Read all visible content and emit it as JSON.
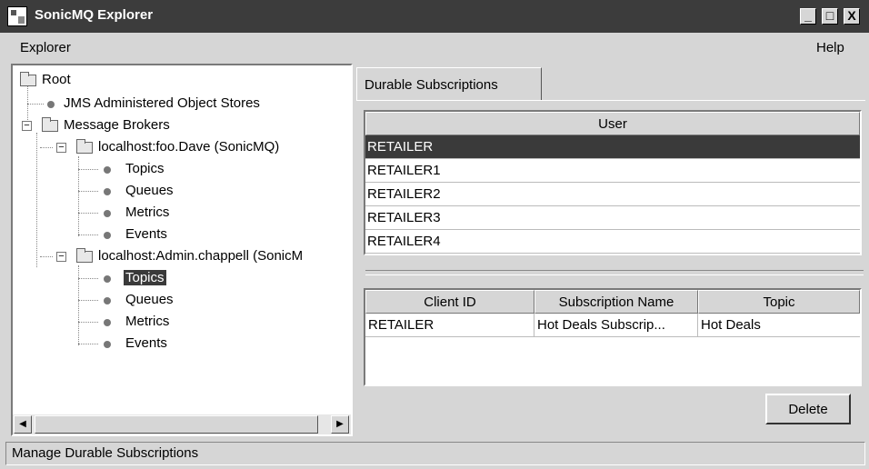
{
  "window": {
    "title": "SonicMQ Explorer",
    "buttons": {
      "minimize": "_",
      "maximize": "□",
      "close": "X"
    }
  },
  "menubar": {
    "explorer": "Explorer",
    "help": "Help"
  },
  "tree": {
    "root": "Root",
    "jms_stores": "JMS Administered Object Stores",
    "message_brokers": "Message Brokers",
    "broker1": {
      "label": "localhost:foo.Dave (SonicMQ)",
      "children": [
        "Topics",
        "Queues",
        "Metrics",
        "Events"
      ]
    },
    "broker2": {
      "label": "localhost:Admin.chappell (SonicM",
      "children": [
        "Topics",
        "Queues",
        "Metrics",
        "Events"
      ],
      "selected_child": "Topics"
    },
    "expander_minus": "−"
  },
  "scrollbar": {
    "left_arrow": "◀",
    "right_arrow": "▶"
  },
  "tabs": [
    "Durable Subscriptions"
  ],
  "user_table": {
    "header": "User",
    "rows": [
      "RETAILER",
      "RETAILER1",
      "RETAILER2",
      "RETAILER3",
      "RETAILER4"
    ],
    "selected": "RETAILER"
  },
  "subscription_table": {
    "headers": [
      "Client ID",
      "Subscription Name",
      "Topic"
    ],
    "rows": [
      [
        "RETAILER",
        "Hot Deals Subscrip...",
        "Hot Deals"
      ]
    ]
  },
  "buttons": {
    "delete": "Delete"
  },
  "status": "Manage Durable Subscriptions",
  "colors": {
    "titlebar": "#3c3c3c",
    "selection": "#3a3a3a",
    "window_bg": "#d6d6d6"
  }
}
